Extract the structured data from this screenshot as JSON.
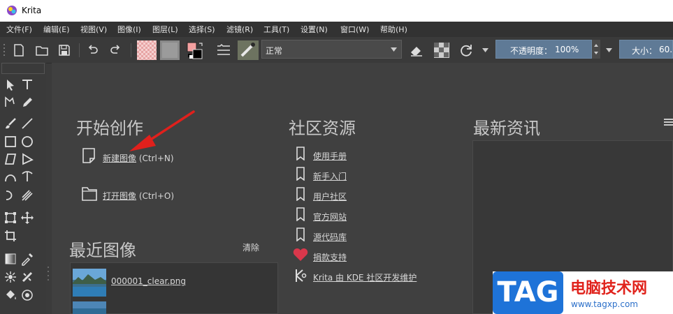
{
  "window": {
    "title": "Krita"
  },
  "menu": [
    "文件(F)",
    "编辑(E)",
    "视图(V)",
    "图像(I)",
    "图层(L)",
    "选择(S)",
    "滤镜(R)",
    "工具(T)",
    "设置(N)",
    "窗口(W)",
    "帮助(H)"
  ],
  "toolbar": {
    "blend_mode": "正常",
    "opacity_label": "不透明度：",
    "opacity_value": "100%",
    "size_label": "大小：",
    "size_value": "60."
  },
  "welcome": {
    "start": {
      "heading": "开始创作",
      "new_image": "新建图像",
      "new_image_shortcut": "(Ctrl+N)",
      "open_image": "打开图像",
      "open_image_shortcut": "(Ctrl+O)"
    },
    "recent": {
      "heading": "最近图像",
      "clear": "清除",
      "items": [
        "000001_clear.png"
      ]
    },
    "community": {
      "heading": "社区资源",
      "links": [
        "使用手册",
        "新手入门",
        "用户社区",
        "官方网站",
        "源代码库",
        "捐款支持",
        "Krita 由 KDE 社区开发维护"
      ]
    },
    "news": {
      "heading": "最新资讯"
    }
  },
  "watermark": {
    "tag": "TAG",
    "site_name": "电脑技术网",
    "url": "www.tagxp.com"
  },
  "colors": {
    "accent_spin": "#5f7a96",
    "heart": "#d9374b",
    "arrow": "#e0201c",
    "watermark_blue": "#1e73d8",
    "watermark_red": "#e0231c"
  }
}
